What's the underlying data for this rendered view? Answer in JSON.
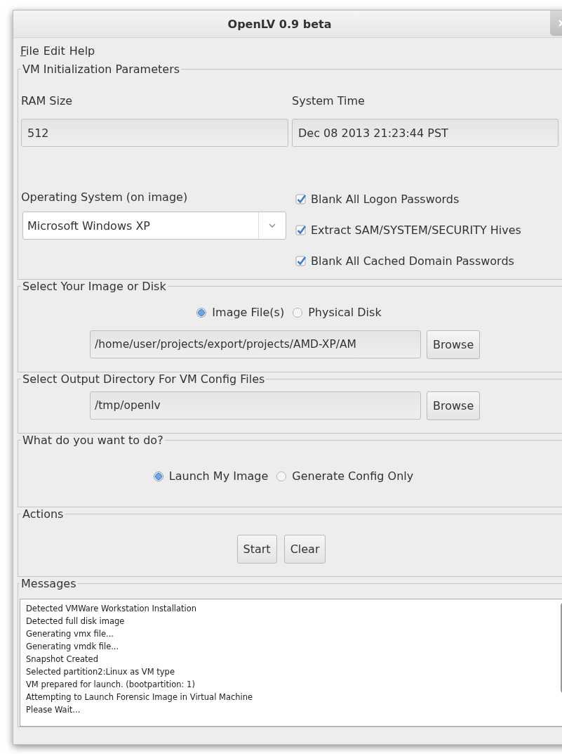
{
  "window": {
    "title": "OpenLV 0.9 beta"
  },
  "menu": [
    {
      "label": "File",
      "underlined": true
    },
    {
      "label": "Edit",
      "underlined": false
    },
    {
      "label": "Help",
      "underlined": false
    }
  ],
  "vm_params": {
    "legend": "VM Initialization Parameters",
    "ram_label": "RAM Size",
    "ram_value": "512",
    "time_label": "System Time",
    "time_value": "Dec 08 2013 21:23:44 PST",
    "os_label": "Operating System (on image)",
    "os_value": "Microsoft Windows XP",
    "options": [
      {
        "label": "Blank All Logon Passwords",
        "checked": true
      },
      {
        "label": "Extract SAM/SYSTEM/SECURITY Hives",
        "checked": true
      },
      {
        "label": "Blank All Cached Domain Passwords",
        "checked": true
      }
    ]
  },
  "image_source": {
    "legend": "Select Your Image or Disk",
    "choices": [
      {
        "label": "Image File(s)",
        "selected": true
      },
      {
        "label": "Physical Disk",
        "selected": false
      }
    ],
    "path": "/home/user/projects/export/projects/AMD-XP/AM",
    "browse": "Browse"
  },
  "output_dir": {
    "legend": "Select Output Directory For VM Config Files",
    "path": "/tmp/openlv",
    "browse": "Browse"
  },
  "mode": {
    "legend": "What do you want to do?",
    "choices": [
      {
        "label": "Launch My Image",
        "selected": true
      },
      {
        "label": "Generate Config Only",
        "selected": false
      }
    ]
  },
  "actions": {
    "legend": "Actions",
    "buttons": [
      "Start",
      "Clear"
    ]
  },
  "messages": {
    "legend": "Messages",
    "lines": [
      "Detected VMWare Workstation Installation",
      "Detected full disk image",
      "Generating vmx file...",
      "Generating vmdk file...",
      "Snapshot Created",
      "Selected partition2:Linux as VM type",
      "VM prepared for launch.  (bootpartition: 1)",
      "Attempting to Launch Forensic Image in Virtual Machine",
      "Please Wait..."
    ]
  }
}
